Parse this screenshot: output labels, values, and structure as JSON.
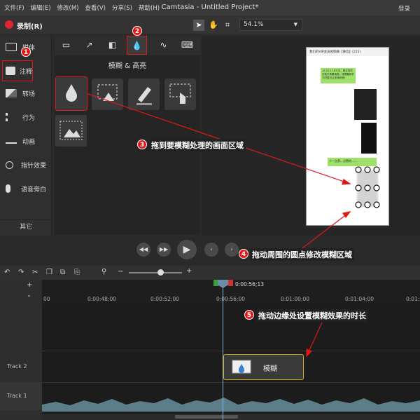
{
  "menubar": {
    "items": [
      "文件(F)",
      "编辑(E)",
      "修改(M)",
      "查看(V)",
      "分享(S)",
      "帮助(H)"
    ],
    "title": "Camtasia - Untitled Project*",
    "login": "登录"
  },
  "toolbar": {
    "record_label": "录制(R)",
    "zoom": "54.1%"
  },
  "sidebar": {
    "items": [
      {
        "label": "媒体",
        "icon": "film-icon"
      },
      {
        "label": "注释",
        "icon": "annotation-icon"
      },
      {
        "label": "转场",
        "icon": "transition-icon"
      },
      {
        "label": "行为",
        "icon": "behavior-icon"
      },
      {
        "label": "动画",
        "icon": "animation-icon"
      },
      {
        "label": "指针效果",
        "icon": "cursor-effect-icon"
      },
      {
        "label": "语音旁白",
        "icon": "microphone-icon"
      }
    ],
    "more": "其它"
  },
  "panel": {
    "title": "模糊 & 高亮"
  },
  "timeline": {
    "ticks": [
      "00",
      "0:00:48;00",
      "0:00:52;00",
      "0:00:56;00",
      "0:01:00;00",
      "0:01:04;00",
      "0:01:0"
    ],
    "playhead_time": "0:00:56;13",
    "tracks": [
      "Track 2",
      "Track 1"
    ],
    "clip_label": "模糊"
  },
  "annotations": {
    "n1": "1",
    "n2": "2",
    "n3": "3",
    "n4": "4",
    "n5": "5",
    "c3": "拖到要模糊处理的画面区域",
    "c4": "拖动周围的圆点修改模糊区域",
    "c5": "拖动边缘处设置模糊效果的时长"
  },
  "phone": {
    "header": "我们的VIP会员视频群【微信】(222)",
    "msg1": "12.23.17:07(中，搞五同学分别不再看视频，请提醒你学习时候可以来找老师)",
    "msg2": "十一点多，点赞的……"
  },
  "colors": {
    "accent_red": "#e01818",
    "clip_border": "#d9a21a",
    "record": "#e0262b"
  }
}
